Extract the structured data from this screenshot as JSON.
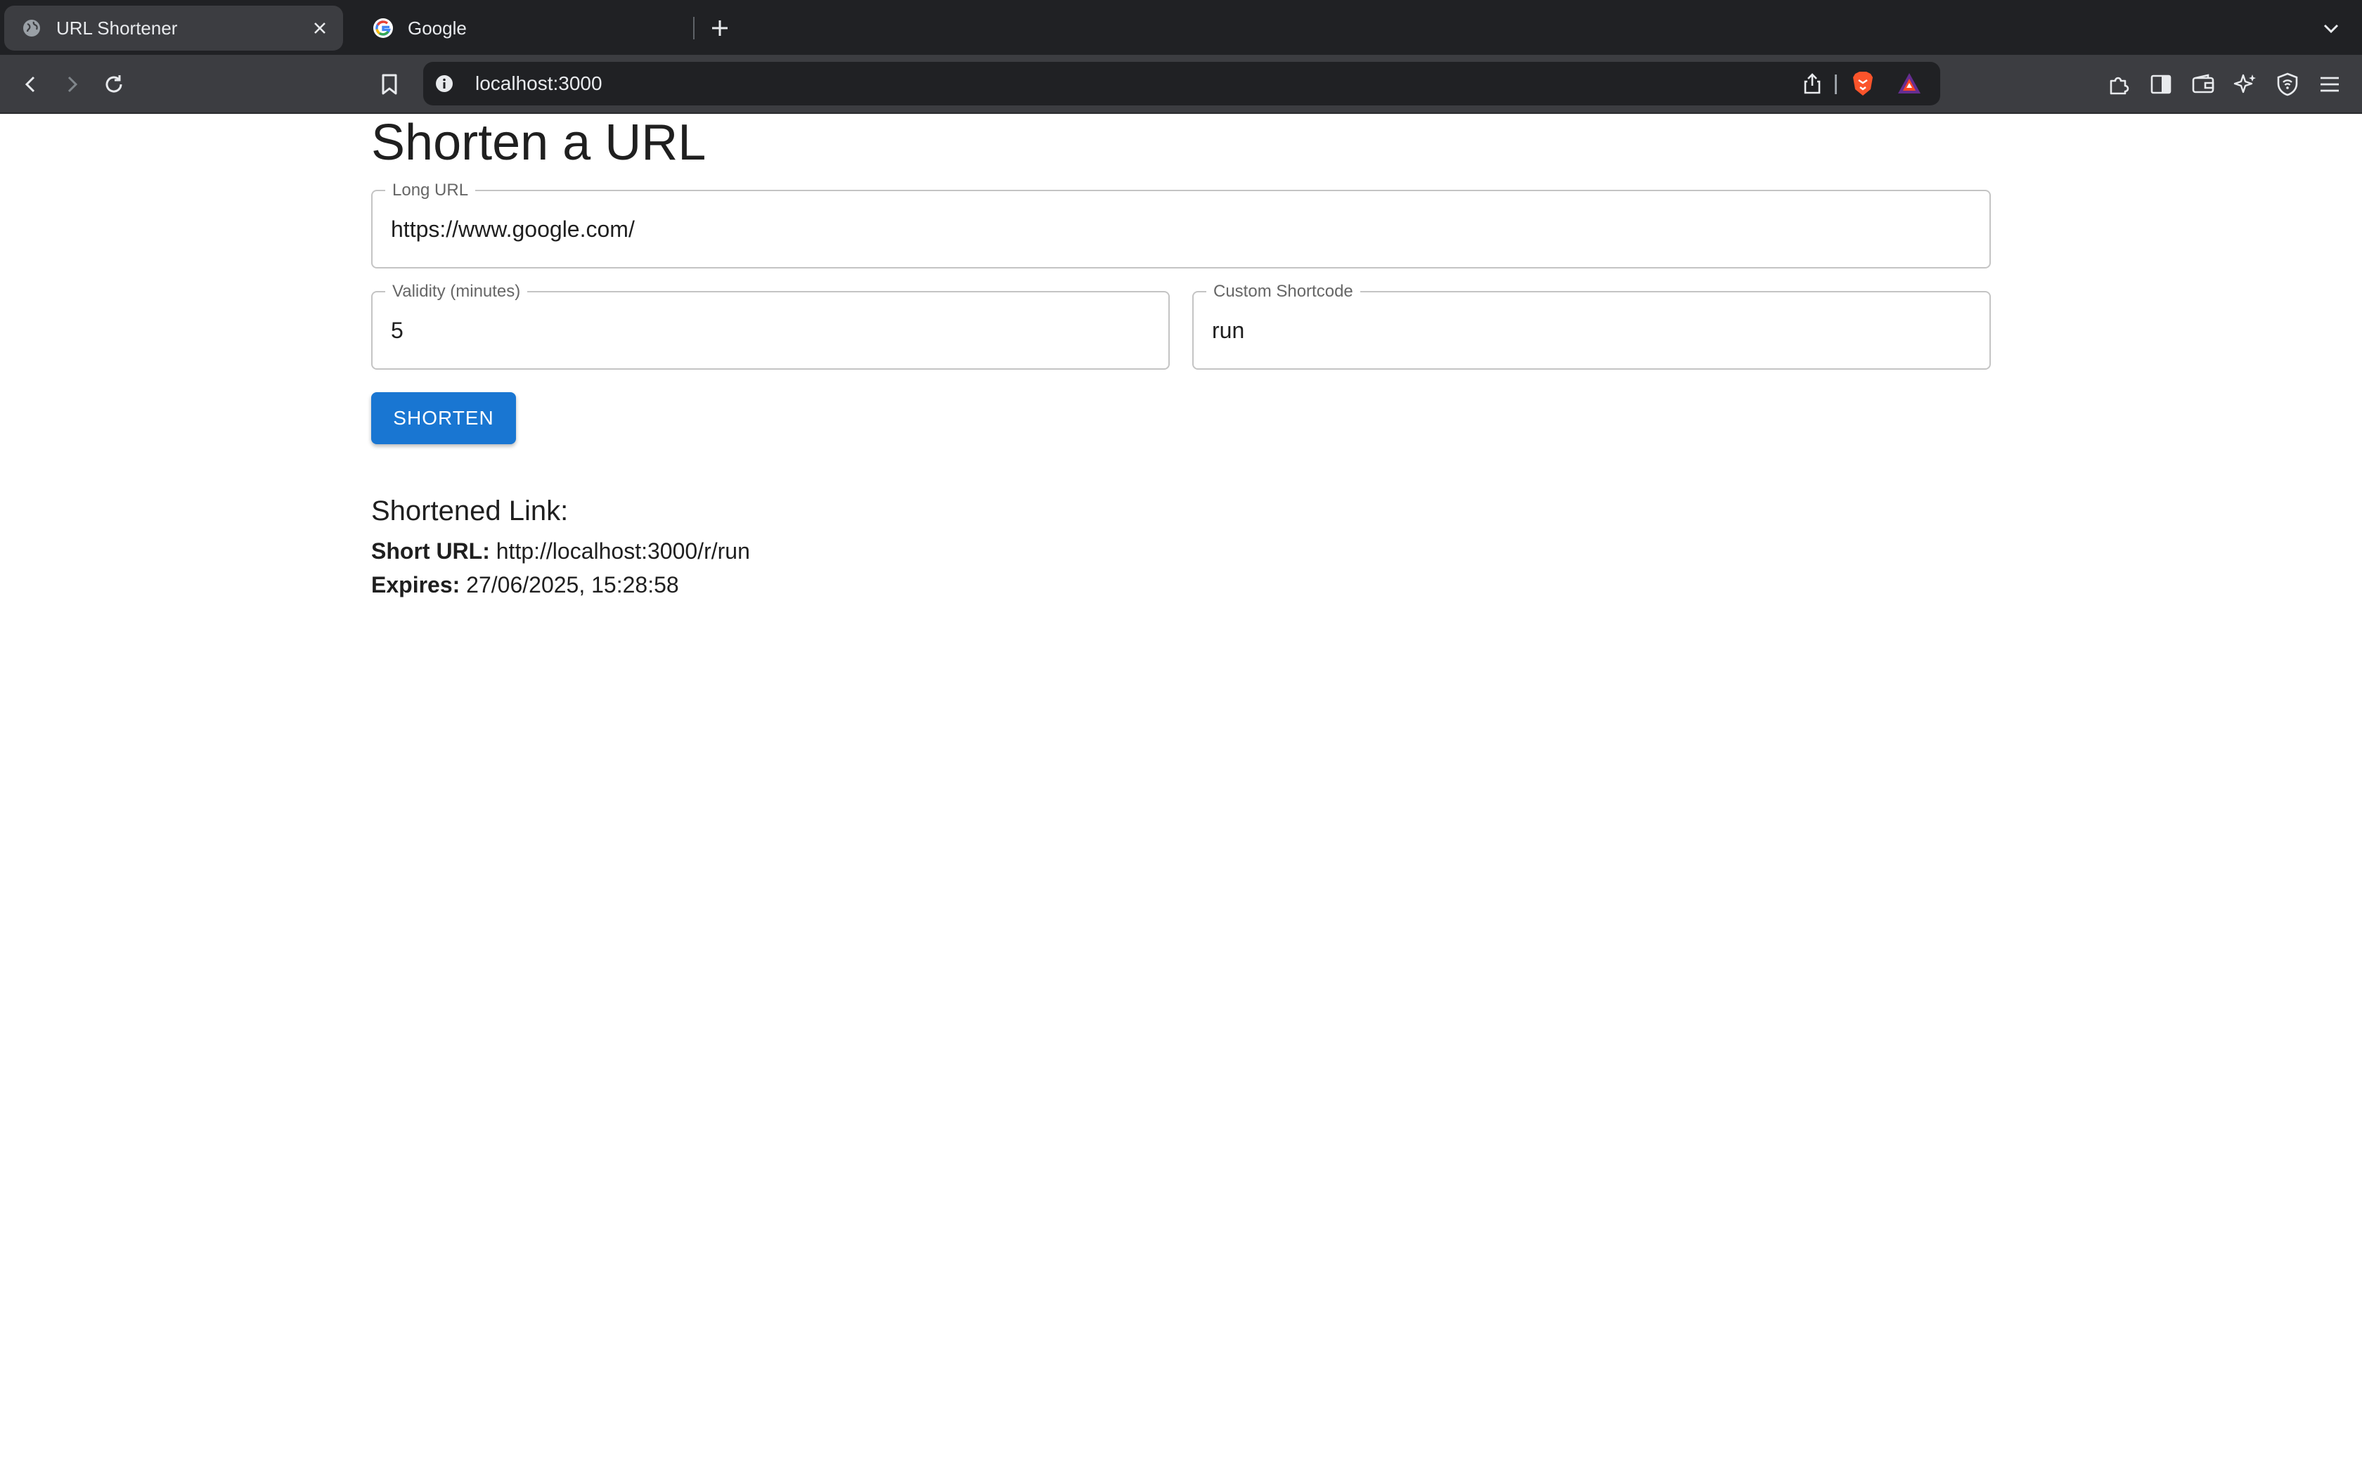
{
  "browser": {
    "tabs": [
      {
        "title": "URL Shortener",
        "active": true,
        "icon": "globe-icon"
      },
      {
        "title": "Google",
        "active": false,
        "icon": "google-icon"
      }
    ],
    "address": "localhost:3000",
    "colors": {
      "chrome_dark": "#202124",
      "chrome_toolbar": "#3c3d41"
    }
  },
  "page": {
    "title": "Shorten a URL",
    "long_url": {
      "label": "Long URL",
      "value": "https://www.google.com/"
    },
    "validity": {
      "label": "Validity (minutes)",
      "value": "5"
    },
    "shortcode": {
      "label": "Custom Shortcode",
      "value": "run"
    },
    "shorten_label": "SHORTEN",
    "result": {
      "heading": "Shortened Link:",
      "short_url_label": "Short URL:",
      "short_url": "http://localhost:3000/r/run",
      "expires_label": "Expires:",
      "expires": "27/06/2025, 15:28:58"
    },
    "colors": {
      "primary": "#1976d2"
    }
  }
}
